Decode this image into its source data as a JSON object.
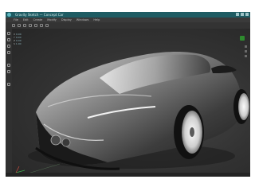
{
  "window": {
    "title": "Gravity Sketch — Concept Car",
    "controls": [
      "minimize",
      "maximize",
      "close"
    ]
  },
  "menubar": {
    "items": [
      "File",
      "Edit",
      "Create",
      "Modify",
      "Display",
      "Windows",
      "Help"
    ]
  },
  "toolbar": {
    "tools": [
      "select-icon",
      "move-icon",
      "rotate-icon",
      "scale-icon",
      "snap-icon",
      "grid-icon",
      "render-icon"
    ]
  },
  "left_toolbar": {
    "icons": [
      "select-icon",
      "move-icon",
      "rotate-icon",
      "scale-icon",
      "pen-icon",
      "lasso-icon",
      "measure-icon"
    ]
  },
  "info_panel": {
    "rows": [
      {
        "label": "X",
        "value": "0.00"
      },
      {
        "label": "Y",
        "value": "0.00"
      },
      {
        "label": "Z",
        "value": "0.00"
      },
      {
        "label": "S",
        "value": "1.00"
      }
    ]
  },
  "viewport": {
    "subject": "sports-car-model",
    "status_icon": "check-icon"
  },
  "colors": {
    "titlebar": "#1f5c63",
    "viewport_bg": "#323232",
    "accent": "#5fb8c2",
    "status_ok": "#2e8b2e"
  }
}
